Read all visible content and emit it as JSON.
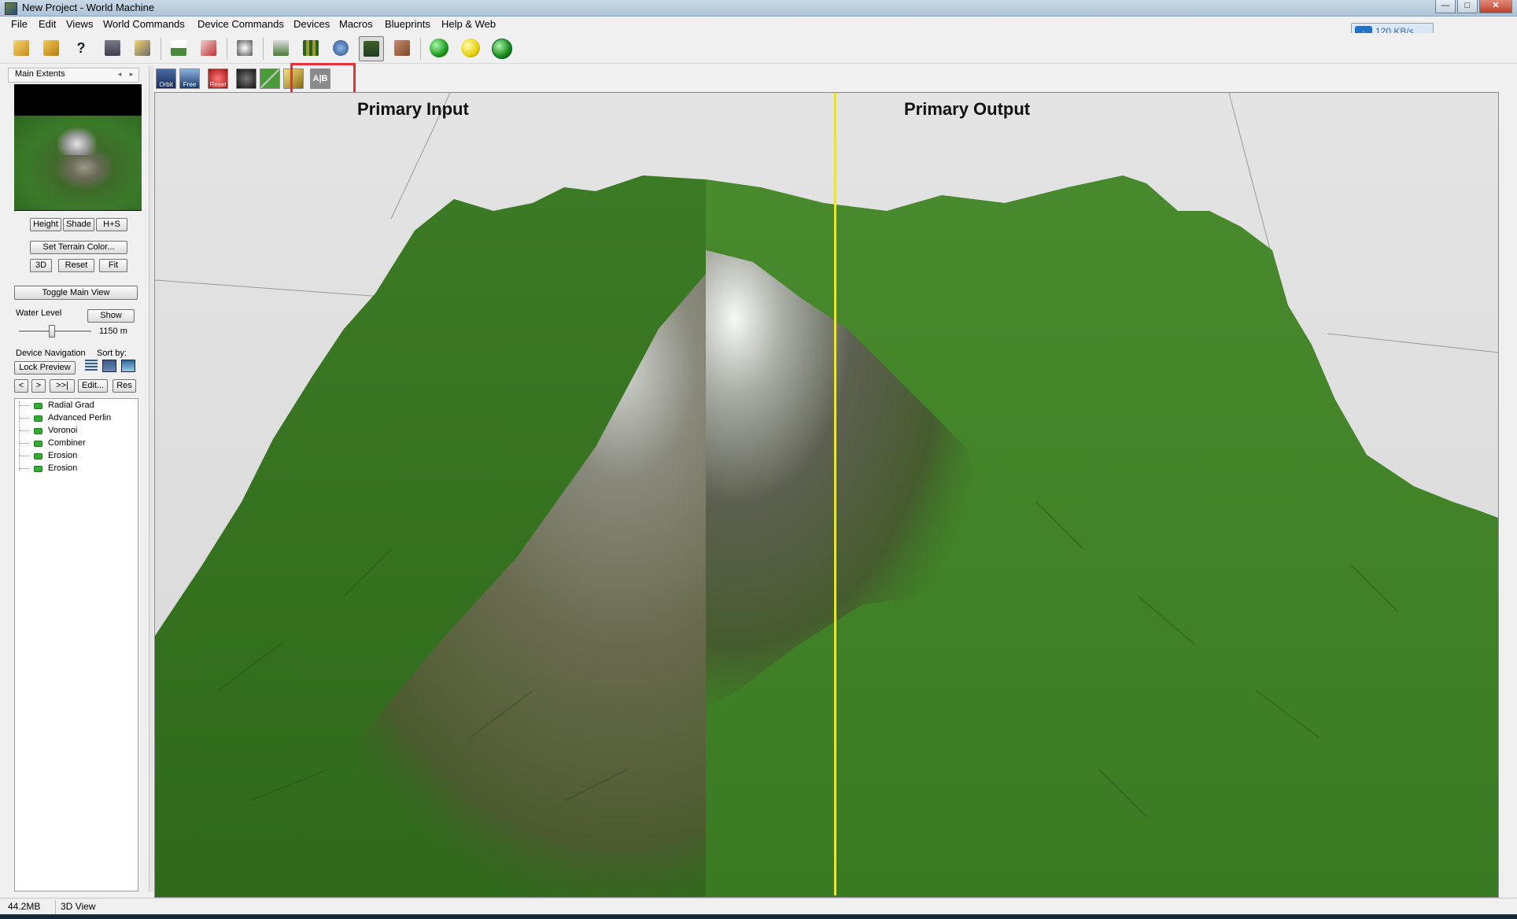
{
  "window": {
    "title": "New Project - World Machine",
    "minimize": "—",
    "maximize": "□",
    "close": "✕"
  },
  "menu": [
    "File",
    "Edit",
    "Views",
    "World Commands",
    "Device Commands",
    "Devices",
    "Macros",
    "Blueprints",
    "Help & Web"
  ],
  "network": {
    "speed": "120 KB/s",
    "icon": "cloud-download-icon"
  },
  "toolbar_icons": [
    "new-project-icon",
    "open-project-icon",
    "help-icon",
    "save-icon",
    "save-as-icon",
    "heightfield-icon",
    "build-icon",
    "render-icon",
    "device-view-icon",
    "layout-view-icon",
    "world-view-icon",
    "3d-view-icon",
    "texture-view-icon",
    "build-green-icon",
    "build-yellow-icon",
    "build-globe-icon"
  ],
  "view_toolbar_icons": [
    "orbit-icon",
    "free-icon",
    "reset-icon",
    "camera-icon",
    "wireframe-icon",
    "lighting-icon",
    "ab-compare-icon"
  ],
  "view_toolbar_text": {
    "orbit": "Orbit",
    "free": "Free",
    "reset": "Reset",
    "ab": "A|B"
  },
  "sidebar": {
    "header": "Main Extents",
    "mode_buttons": [
      "Height",
      "Shade",
      "H+S"
    ],
    "set_color": "Set Terrain Color...",
    "view_buttons": [
      "3D",
      "Reset",
      "Fit"
    ],
    "toggle_main_view": "Toggle Main View",
    "water_level_label": "Water Level",
    "show_button": "Show",
    "water_value": "1150 m",
    "water_level_fraction": 0.45,
    "device_nav_label": "Device Navigation",
    "sort_by_label": "Sort by:",
    "lock_preview": "Lock Preview",
    "nav_buttons": [
      "<",
      ">",
      ">>|"
    ],
    "edit_button": "Edit...",
    "res_button": "Res",
    "devices": [
      "Radial Grad",
      "Advanced Perlin",
      "Voronoi",
      "Combiner",
      "Erosion",
      "Erosion"
    ]
  },
  "viewport": {
    "left_title": "Primary Input",
    "right_title": "Primary Output"
  },
  "status": {
    "memory": "44.2MB",
    "view": "3D View"
  },
  "colors": {
    "highlight": "#e8303a",
    "divider": "#e8e53a",
    "terrain_green": "#3f7f2a"
  }
}
